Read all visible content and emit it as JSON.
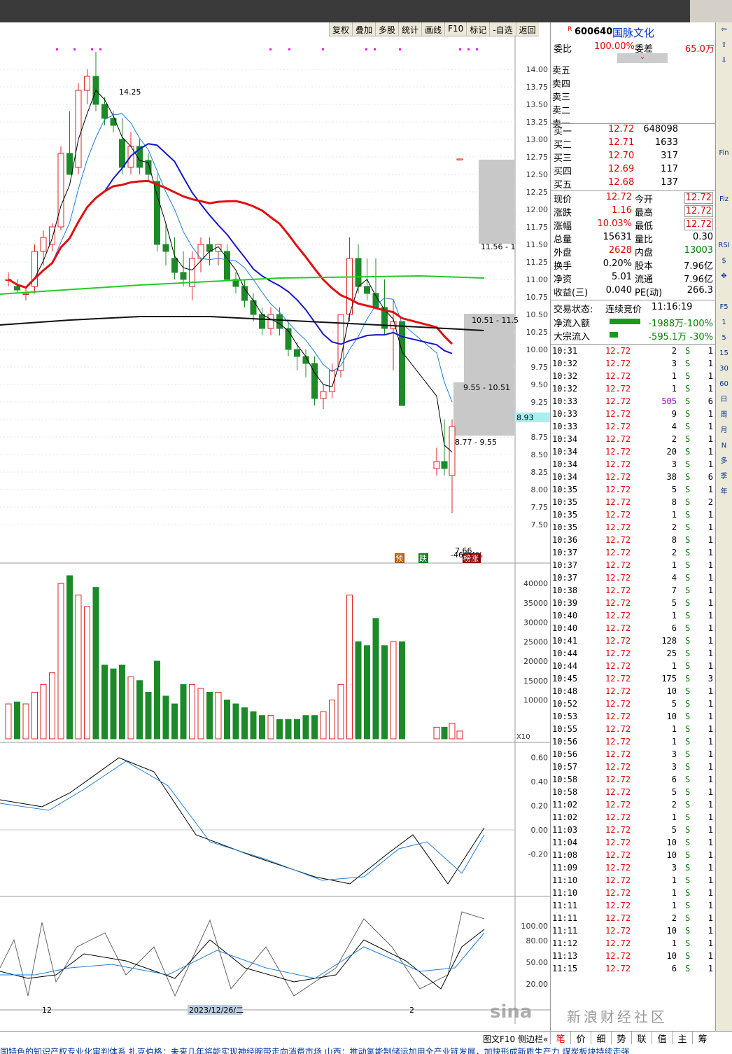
{
  "toolbar": [
    "复权",
    "叠加",
    "多股",
    "统计",
    "画线",
    "F10",
    "标记",
    "-自选",
    "返回"
  ],
  "stock": {
    "prefix": "R",
    "code": "600640",
    "name": "国脉文化"
  },
  "weibi": {
    "label1": "委比",
    "val1": "100.00%",
    "label2": "委差",
    "val2": "65.0万"
  },
  "sells": [
    "卖五",
    "卖四",
    "卖三",
    "卖二",
    "卖一"
  ],
  "buys": [
    {
      "label": "买一",
      "price": "12.72",
      "vol": "648098"
    },
    {
      "label": "买二",
      "price": "12.71",
      "vol": "1633"
    },
    {
      "label": "买三",
      "price": "12.70",
      "vol": "317"
    },
    {
      "label": "买四",
      "price": "12.69",
      "vol": "117"
    },
    {
      "label": "买五",
      "price": "12.68",
      "vol": "137"
    }
  ],
  "quote": [
    {
      "l1": "现价",
      "v1": "12.72",
      "l2": "今开",
      "v2": "12.72"
    },
    {
      "l1": "涨跌",
      "v1": "1.16",
      "l2": "最高",
      "v2": "12.72"
    },
    {
      "l1": "涨幅",
      "v1": "10.03%",
      "l2": "最低",
      "v2": "12.72"
    },
    {
      "l1": "总量",
      "v1": "15631",
      "l2": "量比",
      "v2": "0.30"
    },
    {
      "l1": "外盘",
      "v1": "2628",
      "l2": "内盘",
      "v2": "13003"
    },
    {
      "l1": "换手",
      "v1": "0.20%",
      "l2": "股本",
      "v2": "7.96亿"
    },
    {
      "l1": "净资",
      "v1": "5.01",
      "l2": "流通",
      "v2": "7.96亿"
    },
    {
      "l1": "收益(三)",
      "v1": "0.040",
      "l2": "PE(动)",
      "v2": "266.3"
    }
  ],
  "status": {
    "label": "交易状态:",
    "value": "连续竞价",
    "time": "11:16:19"
  },
  "flows": [
    {
      "label": "净流入额",
      "value": "-1988万-100%"
    },
    {
      "label": "大宗流入",
      "value": "-595.1万 -30%"
    }
  ],
  "trades": [
    [
      "10:31",
      "12.72",
      "2",
      "S",
      "1"
    ],
    [
      "10:32",
      "12.72",
      "3",
      "S",
      "1"
    ],
    [
      "10:32",
      "12.72",
      "1",
      "S",
      "1"
    ],
    [
      "10:32",
      "12.72",
      "1",
      "S",
      "1"
    ],
    [
      "10:33",
      "12.72",
      "505",
      "S",
      "6"
    ],
    [
      "10:33",
      "12.72",
      "9",
      "S",
      "1"
    ],
    [
      "10:33",
      "12.72",
      "4",
      "S",
      "1"
    ],
    [
      "10:34",
      "12.72",
      "2",
      "S",
      "1"
    ],
    [
      "10:34",
      "12.72",
      "20",
      "S",
      "1"
    ],
    [
      "10:34",
      "12.72",
      "3",
      "S",
      "1"
    ],
    [
      "10:34",
      "12.72",
      "38",
      "S",
      "6"
    ],
    [
      "10:35",
      "12.72",
      "5",
      "S",
      "1"
    ],
    [
      "10:35",
      "12.72",
      "8",
      "S",
      "2"
    ],
    [
      "10:35",
      "12.72",
      "1",
      "S",
      "1"
    ],
    [
      "10:35",
      "12.72",
      "2",
      "S",
      "1"
    ],
    [
      "10:36",
      "12.72",
      "8",
      "S",
      "1"
    ],
    [
      "10:37",
      "12.72",
      "2",
      "S",
      "1"
    ],
    [
      "10:37",
      "12.72",
      "1",
      "S",
      "1"
    ],
    [
      "10:37",
      "12.72",
      "4",
      "S",
      "1"
    ],
    [
      "10:38",
      "12.72",
      "7",
      "S",
      "1"
    ],
    [
      "10:39",
      "12.72",
      "5",
      "S",
      "1"
    ],
    [
      "10:40",
      "12.72",
      "1",
      "S",
      "1"
    ],
    [
      "10:40",
      "12.72",
      "6",
      "S",
      "1"
    ],
    [
      "10:41",
      "12.72",
      "128",
      "S",
      "1"
    ],
    [
      "10:44",
      "12.72",
      "25",
      "S",
      "1"
    ],
    [
      "10:44",
      "12.72",
      "1",
      "S",
      "1"
    ],
    [
      "10:45",
      "12.72",
      "175",
      "S",
      "3"
    ],
    [
      "10:48",
      "12.72",
      "10",
      "S",
      "1"
    ],
    [
      "10:52",
      "12.72",
      "5",
      "S",
      "1"
    ],
    [
      "10:53",
      "12.72",
      "10",
      "S",
      "1"
    ],
    [
      "10:55",
      "12.72",
      "1",
      "S",
      "1"
    ],
    [
      "10:56",
      "12.72",
      "1",
      "S",
      "1"
    ],
    [
      "10:56",
      "12.72",
      "3",
      "S",
      "1"
    ],
    [
      "10:57",
      "12.72",
      "3",
      "S",
      "1"
    ],
    [
      "10:58",
      "12.72",
      "6",
      "S",
      "1"
    ],
    [
      "10:58",
      "12.72",
      "5",
      "S",
      "1"
    ],
    [
      "11:02",
      "12.72",
      "2",
      "S",
      "1"
    ],
    [
      "11:02",
      "12.72",
      "1",
      "S",
      "1"
    ],
    [
      "11:03",
      "12.72",
      "5",
      "S",
      "1"
    ],
    [
      "11:04",
      "12.72",
      "10",
      "S",
      "1"
    ],
    [
      "11:08",
      "12.72",
      "10",
      "S",
      "1"
    ],
    [
      "11:09",
      "12.72",
      "3",
      "S",
      "1"
    ],
    [
      "11:10",
      "12.72",
      "1",
      "S",
      "1"
    ],
    [
      "11:10",
      "12.72",
      "1",
      "S",
      "1"
    ],
    [
      "11:11",
      "12.72",
      "1",
      "S",
      "1"
    ],
    [
      "11:11",
      "12.72",
      "2",
      "S",
      "1"
    ],
    [
      "11:11",
      "12.72",
      "10",
      "S",
      "1"
    ],
    [
      "11:12",
      "12.72",
      "1",
      "S",
      "1"
    ],
    [
      "11:13",
      "12.72",
      "10",
      "S",
      "1"
    ],
    [
      "11:15",
      "12.72",
      "6",
      "S",
      "1"
    ]
  ],
  "sidebar": [
    "⇦",
    "⇧",
    "⇩",
    "",
    "",
    "",
    "",
    "",
    "Fin",
    "",
    "",
    "Fiz",
    "",
    "",
    "RSI",
    "$",
    "✥",
    "",
    "F5",
    "1",
    "5",
    "15",
    "30",
    "60",
    "日",
    "周",
    "月",
    "N",
    "多",
    "季",
    "年"
  ],
  "bottom_tabs": [
    "笔",
    "价",
    "细",
    "势",
    "联",
    "值",
    "主",
    "筹"
  ],
  "bottom_left": "图文F10 侧边栏«",
  "ticker": "国特色的知识产权专业化审判体系      扎克伯格：未来几年将能实现神经腕带走向消费市场      山西：推动氢能制储运加用全产业链发展，加快形成新质生产力      煤炭板块持续走强",
  "watermark": {
    "logo": "sina",
    "text": "新浪财经社区"
  },
  "chart_data": {
    "type": "candlestick",
    "price_axis": [
      "14.00",
      "13.75",
      "13.50",
      "13.25",
      "13.00",
      "12.75",
      "12.50",
      "12.25",
      "12.00",
      "11.75",
      "11.50",
      "11.25",
      "11.00",
      "10.75",
      "10.50",
      "10.25",
      "10.00",
      "9.75",
      "9.50",
      "9.25",
      "9.00",
      "8.75",
      "8.50",
      "8.25",
      "8.00",
      "7.75",
      "7.50"
    ],
    "ylim": [
      7.4,
      14.3
    ],
    "high_label": "14.25",
    "low_label": "7.66",
    "low_pct": "-46.24%",
    "current_label": "8.93",
    "bands": [
      "11.56 - 1",
      "10.51 - 11.5",
      "9.55 - 10.51",
      "8.77 - 9.55"
    ],
    "tags": [
      "预",
      "跌",
      "榜涨"
    ],
    "candles": [
      [
        11.0,
        11.1,
        10.9,
        11.0
      ],
      [
        10.9,
        11.0,
        10.8,
        10.85
      ],
      [
        10.8,
        10.9,
        10.7,
        10.8
      ],
      [
        10.9,
        11.5,
        10.8,
        11.4
      ],
      [
        11.4,
        11.7,
        11.2,
        11.6
      ],
      [
        11.5,
        11.8,
        11.4,
        11.75
      ],
      [
        11.75,
        12.9,
        11.7,
        12.8
      ],
      [
        12.8,
        13.4,
        12.5,
        12.5
      ],
      [
        12.6,
        13.8,
        12.5,
        13.7
      ],
      [
        13.7,
        14.0,
        13.5,
        13.9
      ],
      [
        13.9,
        14.25,
        13.4,
        13.5
      ],
      [
        13.5,
        13.6,
        13.2,
        13.3
      ],
      [
        13.3,
        13.4,
        13.1,
        13.2
      ],
      [
        13.0,
        13.3,
        12.5,
        12.6
      ],
      [
        12.6,
        13.1,
        12.5,
        12.9
      ],
      [
        12.9,
        13.0,
        12.5,
        12.6
      ],
      [
        12.7,
        12.8,
        12.4,
        12.5
      ],
      [
        12.4,
        12.5,
        11.4,
        11.5
      ],
      [
        11.5,
        11.8,
        11.2,
        11.4
      ],
      [
        11.3,
        11.6,
        11.0,
        11.1
      ],
      [
        11.1,
        11.4,
        10.9,
        11.0
      ],
      [
        10.9,
        11.4,
        10.7,
        11.3
      ],
      [
        11.3,
        11.6,
        11.1,
        11.5
      ],
      [
        11.5,
        11.6,
        11.2,
        11.4
      ],
      [
        11.4,
        11.5,
        11.2,
        11.5
      ],
      [
        11.4,
        11.5,
        11.0,
        11.0
      ],
      [
        11.0,
        11.1,
        10.8,
        10.9
      ],
      [
        10.9,
        11.0,
        10.6,
        10.7
      ],
      [
        10.7,
        10.8,
        10.4,
        10.5
      ],
      [
        10.5,
        10.6,
        10.2,
        10.3
      ],
      [
        10.3,
        10.6,
        10.2,
        10.5
      ],
      [
        10.5,
        10.6,
        10.2,
        10.3
      ],
      [
        10.3,
        10.4,
        9.9,
        10.0
      ],
      [
        10.0,
        10.1,
        9.7,
        9.9
      ],
      [
        9.9,
        10.0,
        9.6,
        9.8
      ],
      [
        9.8,
        9.9,
        9.2,
        9.3
      ],
      [
        9.3,
        9.5,
        9.15,
        9.4
      ],
      [
        9.4,
        9.8,
        9.3,
        9.7
      ],
      [
        9.7,
        10.5,
        9.6,
        10.5
      ],
      [
        10.5,
        11.6,
        10.4,
        11.3
      ],
      [
        11.3,
        11.5,
        10.8,
        10.9
      ],
      [
        10.9,
        11.3,
        10.7,
        10.8
      ],
      [
        10.8,
        11.3,
        10.6,
        10.6
      ],
      [
        10.6,
        11.0,
        10.2,
        10.3
      ],
      [
        10.3,
        10.7,
        9.7,
        10.4
      ],
      [
        10.4,
        10.4,
        9.2,
        9.2
      ],
      [
        8.3,
        8.6,
        8.2,
        8.4
      ],
      [
        8.4,
        9.0,
        8.2,
        8.3
      ],
      [
        8.2,
        9.0,
        7.66,
        8.9
      ],
      [
        12.72,
        12.72,
        12.72,
        12.72
      ]
    ],
    "volume_axis": [
      "40000",
      "35000",
      "30000",
      "25000",
      "20000",
      "15000",
      "10000"
    ],
    "volume_unit": "X10",
    "macd_axis": [
      "0.60",
      "0.40",
      "0.20",
      "0.00",
      "-0.20"
    ],
    "kdj_axis": [
      "100.00",
      "80.00",
      "50.00",
      "20.00"
    ],
    "date_labels": [
      "12",
      "2023/12/26/二",
      "2"
    ]
  }
}
